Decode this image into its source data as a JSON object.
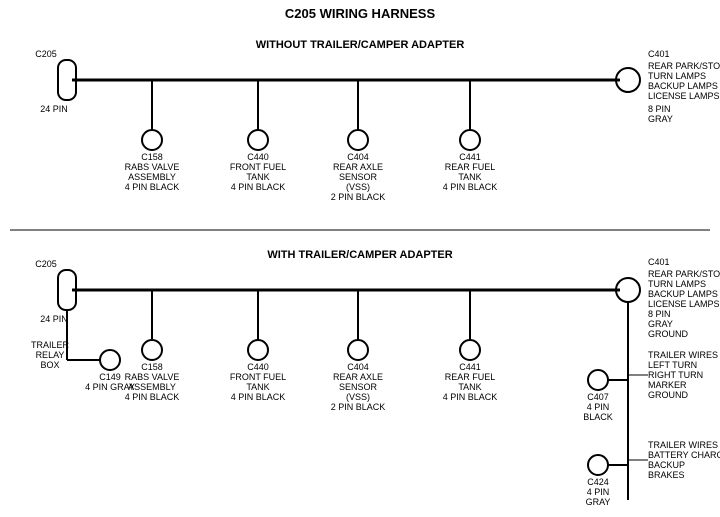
{
  "diagram": {
    "title": "C205 WIRING HARNESS",
    "section1": {
      "label": "WITHOUT  TRAILER/CAMPER  ADAPTER"
    },
    "section2": {
      "label": "WITH  TRAILER/CAMPER  ADAPTER"
    }
  }
}
